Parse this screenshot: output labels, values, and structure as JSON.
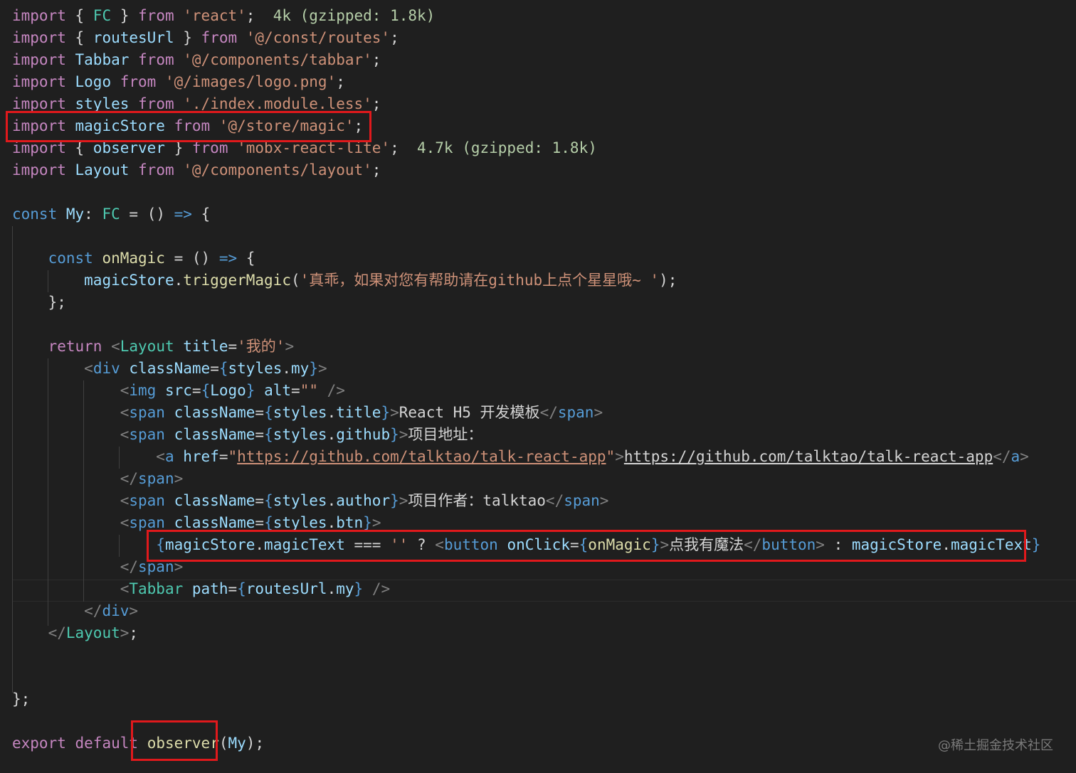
{
  "colors": {
    "background": "#1f1f1f",
    "keyword": "#c586c0",
    "storage_keyword": "#569cd6",
    "variable": "#9cdcfe",
    "type": "#4ec9b0",
    "function": "#dcdcaa",
    "string": "#ce9178",
    "tag": "#569cd6",
    "attribute": "#9cdcfe",
    "jsx_bracket": "#808080",
    "text": "#d4d4d4",
    "import_cost_hint": "#b5cea8",
    "annotation_box": "#e0191c"
  },
  "code_lines": [
    {
      "tokens": [
        {
          "t": "import",
          "c": "kw"
        },
        {
          "t": " { ",
          "c": "punc"
        },
        {
          "t": "FC",
          "c": "type"
        },
        {
          "t": " } ",
          "c": "punc"
        },
        {
          "t": "from",
          "c": "kw"
        },
        {
          "t": " ",
          "c": "punc"
        },
        {
          "t": "'react'",
          "c": "str"
        },
        {
          "t": ";  ",
          "c": "punc"
        },
        {
          "t": "4k (gzipped: 1.8k)",
          "c": "hint"
        }
      ]
    },
    {
      "tokens": [
        {
          "t": "import",
          "c": "kw"
        },
        {
          "t": " { ",
          "c": "punc"
        },
        {
          "t": "routesUrl",
          "c": "var"
        },
        {
          "t": " } ",
          "c": "punc"
        },
        {
          "t": "from",
          "c": "kw"
        },
        {
          "t": " ",
          "c": "punc"
        },
        {
          "t": "'@/const/routes'",
          "c": "str"
        },
        {
          "t": ";",
          "c": "punc"
        }
      ]
    },
    {
      "tokens": [
        {
          "t": "import",
          "c": "kw"
        },
        {
          "t": " ",
          "c": "punc"
        },
        {
          "t": "Tabbar",
          "c": "var"
        },
        {
          "t": " ",
          "c": "punc"
        },
        {
          "t": "from",
          "c": "kw"
        },
        {
          "t": " ",
          "c": "punc"
        },
        {
          "t": "'@/components/tabbar'",
          "c": "str"
        },
        {
          "t": ";",
          "c": "punc"
        }
      ]
    },
    {
      "tokens": [
        {
          "t": "import",
          "c": "kw"
        },
        {
          "t": " ",
          "c": "punc"
        },
        {
          "t": "Logo",
          "c": "var"
        },
        {
          "t": " ",
          "c": "punc"
        },
        {
          "t": "from",
          "c": "kw"
        },
        {
          "t": " ",
          "c": "punc"
        },
        {
          "t": "'@/images/logo.png'",
          "c": "str"
        },
        {
          "t": ";",
          "c": "punc"
        }
      ]
    },
    {
      "tokens": [
        {
          "t": "import",
          "c": "kw"
        },
        {
          "t": " ",
          "c": "punc"
        },
        {
          "t": "styles",
          "c": "var"
        },
        {
          "t": " ",
          "c": "punc"
        },
        {
          "t": "from",
          "c": "kw"
        },
        {
          "t": " ",
          "c": "punc"
        },
        {
          "t": "'./index.module.less'",
          "c": "str"
        },
        {
          "t": ";",
          "c": "punc"
        }
      ]
    },
    {
      "tokens": [
        {
          "t": "import",
          "c": "kw"
        },
        {
          "t": " ",
          "c": "punc"
        },
        {
          "t": "magicStore",
          "c": "var"
        },
        {
          "t": " ",
          "c": "punc"
        },
        {
          "t": "from",
          "c": "kw"
        },
        {
          "t": " ",
          "c": "punc"
        },
        {
          "t": "'@/store/magic'",
          "c": "str"
        },
        {
          "t": ";",
          "c": "punc"
        }
      ]
    },
    {
      "tokens": [
        {
          "t": "import",
          "c": "kw"
        },
        {
          "t": " { ",
          "c": "punc"
        },
        {
          "t": "observer",
          "c": "var"
        },
        {
          "t": " } ",
          "c": "punc"
        },
        {
          "t": "from",
          "c": "kw"
        },
        {
          "t": " ",
          "c": "punc"
        },
        {
          "t": "'mobx-react-lite'",
          "c": "str"
        },
        {
          "t": ";  ",
          "c": "punc"
        },
        {
          "t": "4.7k (gzipped: 1.8k)",
          "c": "hint"
        }
      ]
    },
    {
      "tokens": [
        {
          "t": "import",
          "c": "kw"
        },
        {
          "t": " ",
          "c": "punc"
        },
        {
          "t": "Layout",
          "c": "var"
        },
        {
          "t": " ",
          "c": "punc"
        },
        {
          "t": "from",
          "c": "kw"
        },
        {
          "t": " ",
          "c": "punc"
        },
        {
          "t": "'@/components/layout'",
          "c": "str"
        },
        {
          "t": ";",
          "c": "punc"
        }
      ]
    },
    {
      "tokens": []
    },
    {
      "tokens": [
        {
          "t": "const",
          "c": "sk"
        },
        {
          "t": " ",
          "c": "punc"
        },
        {
          "t": "My",
          "c": "var"
        },
        {
          "t": ": ",
          "c": "punc"
        },
        {
          "t": "FC",
          "c": "type"
        },
        {
          "t": " = () ",
          "c": "punc"
        },
        {
          "t": "=>",
          "c": "sk"
        },
        {
          "t": " {",
          "c": "punc"
        }
      ]
    },
    {
      "tokens": []
    },
    {
      "tokens": [
        {
          "t": "    ",
          "c": "punc"
        },
        {
          "t": "const",
          "c": "sk"
        },
        {
          "t": " ",
          "c": "punc"
        },
        {
          "t": "onMagic",
          "c": "fn"
        },
        {
          "t": " = () ",
          "c": "punc"
        },
        {
          "t": "=>",
          "c": "sk"
        },
        {
          "t": " {",
          "c": "punc"
        }
      ]
    },
    {
      "tokens": [
        {
          "t": "        ",
          "c": "punc"
        },
        {
          "t": "magicStore",
          "c": "var"
        },
        {
          "t": ".",
          "c": "punc"
        },
        {
          "t": "triggerMagic",
          "c": "fn"
        },
        {
          "t": "(",
          "c": "punc"
        },
        {
          "t": "'真乖，如果对您有帮助请在github上点个星星哦~ '",
          "c": "str"
        },
        {
          "t": ");",
          "c": "punc"
        }
      ]
    },
    {
      "tokens": [
        {
          "t": "    };",
          "c": "punc"
        }
      ]
    },
    {
      "tokens": []
    },
    {
      "tokens": [
        {
          "t": "    ",
          "c": "punc"
        },
        {
          "t": "return",
          "c": "kw"
        },
        {
          "t": " ",
          "c": "punc"
        },
        {
          "t": "<",
          "c": "br"
        },
        {
          "t": "Layout",
          "c": "type"
        },
        {
          "t": " ",
          "c": "punc"
        },
        {
          "t": "title",
          "c": "attr"
        },
        {
          "t": "=",
          "c": "punc"
        },
        {
          "t": "'我的'",
          "c": "str"
        },
        {
          "t": ">",
          "c": "br"
        }
      ]
    },
    {
      "tokens": [
        {
          "t": "        ",
          "c": "punc"
        },
        {
          "t": "<",
          "c": "br"
        },
        {
          "t": "div",
          "c": "tag"
        },
        {
          "t": " ",
          "c": "punc"
        },
        {
          "t": "className",
          "c": "attr"
        },
        {
          "t": "=",
          "c": "punc"
        },
        {
          "t": "{",
          "c": "sk"
        },
        {
          "t": "styles",
          "c": "var"
        },
        {
          "t": ".",
          "c": "punc"
        },
        {
          "t": "my",
          "c": "var"
        },
        {
          "t": "}",
          "c": "sk"
        },
        {
          "t": ">",
          "c": "br"
        }
      ]
    },
    {
      "tokens": [
        {
          "t": "            ",
          "c": "punc"
        },
        {
          "t": "<",
          "c": "br"
        },
        {
          "t": "img",
          "c": "tag"
        },
        {
          "t": " ",
          "c": "punc"
        },
        {
          "t": "src",
          "c": "attr"
        },
        {
          "t": "=",
          "c": "punc"
        },
        {
          "t": "{",
          "c": "sk"
        },
        {
          "t": "Logo",
          "c": "var"
        },
        {
          "t": "}",
          "c": "sk"
        },
        {
          "t": " ",
          "c": "punc"
        },
        {
          "t": "alt",
          "c": "attr"
        },
        {
          "t": "=",
          "c": "punc"
        },
        {
          "t": "\"\"",
          "c": "str"
        },
        {
          "t": " />",
          "c": "br"
        }
      ]
    },
    {
      "tokens": [
        {
          "t": "            ",
          "c": "punc"
        },
        {
          "t": "<",
          "c": "br"
        },
        {
          "t": "span",
          "c": "tag"
        },
        {
          "t": " ",
          "c": "punc"
        },
        {
          "t": "className",
          "c": "attr"
        },
        {
          "t": "=",
          "c": "punc"
        },
        {
          "t": "{",
          "c": "sk"
        },
        {
          "t": "styles",
          "c": "var"
        },
        {
          "t": ".",
          "c": "punc"
        },
        {
          "t": "title",
          "c": "var"
        },
        {
          "t": "}",
          "c": "sk"
        },
        {
          "t": ">",
          "c": "br"
        },
        {
          "t": "React H5 开发模板",
          "c": "txt"
        },
        {
          "t": "</",
          "c": "br"
        },
        {
          "t": "span",
          "c": "tag"
        },
        {
          "t": ">",
          "c": "br"
        }
      ]
    },
    {
      "tokens": [
        {
          "t": "            ",
          "c": "punc"
        },
        {
          "t": "<",
          "c": "br"
        },
        {
          "t": "span",
          "c": "tag"
        },
        {
          "t": " ",
          "c": "punc"
        },
        {
          "t": "className",
          "c": "attr"
        },
        {
          "t": "=",
          "c": "punc"
        },
        {
          "t": "{",
          "c": "sk"
        },
        {
          "t": "styles",
          "c": "var"
        },
        {
          "t": ".",
          "c": "punc"
        },
        {
          "t": "github",
          "c": "var"
        },
        {
          "t": "}",
          "c": "sk"
        },
        {
          "t": ">",
          "c": "br"
        },
        {
          "t": "项目地址：",
          "c": "txt"
        }
      ]
    },
    {
      "tokens": [
        {
          "t": "                ",
          "c": "punc"
        },
        {
          "t": "<",
          "c": "br"
        },
        {
          "t": "a",
          "c": "tag"
        },
        {
          "t": " ",
          "c": "punc"
        },
        {
          "t": "href",
          "c": "attr"
        },
        {
          "t": "=",
          "c": "punc"
        },
        {
          "t": "\"",
          "c": "str"
        },
        {
          "t": "https://github.com/talktao/talk-react-app",
          "c": "str",
          "u": true
        },
        {
          "t": "\"",
          "c": "str"
        },
        {
          "t": ">",
          "c": "br"
        },
        {
          "t": "https://github.com/talktao/talk-react-app",
          "c": "txt",
          "u": true
        },
        {
          "t": "</",
          "c": "br"
        },
        {
          "t": "a",
          "c": "tag"
        },
        {
          "t": ">",
          "c": "br"
        }
      ]
    },
    {
      "tokens": [
        {
          "t": "            ",
          "c": "punc"
        },
        {
          "t": "</",
          "c": "br"
        },
        {
          "t": "span",
          "c": "tag"
        },
        {
          "t": ">",
          "c": "br"
        }
      ]
    },
    {
      "tokens": [
        {
          "t": "            ",
          "c": "punc"
        },
        {
          "t": "<",
          "c": "br"
        },
        {
          "t": "span",
          "c": "tag"
        },
        {
          "t": " ",
          "c": "punc"
        },
        {
          "t": "className",
          "c": "attr"
        },
        {
          "t": "=",
          "c": "punc"
        },
        {
          "t": "{",
          "c": "sk"
        },
        {
          "t": "styles",
          "c": "var"
        },
        {
          "t": ".",
          "c": "punc"
        },
        {
          "t": "author",
          "c": "var"
        },
        {
          "t": "}",
          "c": "sk"
        },
        {
          "t": ">",
          "c": "br"
        },
        {
          "t": "项目作者：talktao",
          "c": "txt"
        },
        {
          "t": "</",
          "c": "br"
        },
        {
          "t": "span",
          "c": "tag"
        },
        {
          "t": ">",
          "c": "br"
        }
      ]
    },
    {
      "tokens": [
        {
          "t": "            ",
          "c": "punc"
        },
        {
          "t": "<",
          "c": "br"
        },
        {
          "t": "span",
          "c": "tag"
        },
        {
          "t": " ",
          "c": "punc"
        },
        {
          "t": "className",
          "c": "attr"
        },
        {
          "t": "=",
          "c": "punc"
        },
        {
          "t": "{",
          "c": "sk"
        },
        {
          "t": "styles",
          "c": "var"
        },
        {
          "t": ".",
          "c": "punc"
        },
        {
          "t": "btn",
          "c": "var"
        },
        {
          "t": "}",
          "c": "sk"
        },
        {
          "t": ">",
          "c": "br"
        }
      ]
    },
    {
      "tokens": [
        {
          "t": "                ",
          "c": "punc"
        },
        {
          "t": "{",
          "c": "sk"
        },
        {
          "t": "magicStore",
          "c": "var"
        },
        {
          "t": ".",
          "c": "punc"
        },
        {
          "t": "magicText",
          "c": "var"
        },
        {
          "t": " === ",
          "c": "punc"
        },
        {
          "t": "''",
          "c": "str"
        },
        {
          "t": " ? ",
          "c": "punc"
        },
        {
          "t": "<",
          "c": "br"
        },
        {
          "t": "button",
          "c": "tag"
        },
        {
          "t": " ",
          "c": "punc"
        },
        {
          "t": "onClick",
          "c": "attr"
        },
        {
          "t": "=",
          "c": "punc"
        },
        {
          "t": "{",
          "c": "sk"
        },
        {
          "t": "onMagic",
          "c": "fn"
        },
        {
          "t": "}",
          "c": "sk"
        },
        {
          "t": ">",
          "c": "br"
        },
        {
          "t": "点我有魔法",
          "c": "txt"
        },
        {
          "t": "</",
          "c": "br"
        },
        {
          "t": "button",
          "c": "tag"
        },
        {
          "t": ">",
          "c": "br"
        },
        {
          "t": " : ",
          "c": "punc"
        },
        {
          "t": "magicStore",
          "c": "var"
        },
        {
          "t": ".",
          "c": "punc"
        },
        {
          "t": "magicText",
          "c": "var"
        },
        {
          "t": "}",
          "c": "sk"
        }
      ]
    },
    {
      "tokens": [
        {
          "t": "            ",
          "c": "punc"
        },
        {
          "t": "</",
          "c": "br"
        },
        {
          "t": "span",
          "c": "tag"
        },
        {
          "t": ">",
          "c": "br"
        }
      ]
    },
    {
      "tokens": [
        {
          "t": "            ",
          "c": "punc"
        },
        {
          "t": "<",
          "c": "br"
        },
        {
          "t": "Tabbar",
          "c": "type"
        },
        {
          "t": " ",
          "c": "punc"
        },
        {
          "t": "path",
          "c": "attr"
        },
        {
          "t": "=",
          "c": "punc"
        },
        {
          "t": "{",
          "c": "sk"
        },
        {
          "t": "routesUrl",
          "c": "var"
        },
        {
          "t": ".",
          "c": "punc"
        },
        {
          "t": "my",
          "c": "var"
        },
        {
          "t": "}",
          "c": "sk"
        },
        {
          "t": " />",
          "c": "br"
        }
      ]
    },
    {
      "tokens": [
        {
          "t": "        ",
          "c": "punc"
        },
        {
          "t": "</",
          "c": "br"
        },
        {
          "t": "div",
          "c": "tag"
        },
        {
          "t": ">",
          "c": "br"
        }
      ]
    },
    {
      "tokens": [
        {
          "t": "    ",
          "c": "punc"
        },
        {
          "t": "</",
          "c": "br"
        },
        {
          "t": "Layout",
          "c": "type"
        },
        {
          "t": ">",
          "c": "br"
        },
        {
          "t": ";",
          "c": "punc"
        }
      ]
    },
    {
      "tokens": []
    },
    {
      "tokens": []
    },
    {
      "tokens": [
        {
          "t": "};",
          "c": "punc"
        }
      ]
    },
    {
      "tokens": []
    },
    {
      "tokens": [
        {
          "t": "export",
          "c": "kw"
        },
        {
          "t": " ",
          "c": "punc"
        },
        {
          "t": "default",
          "c": "kw"
        },
        {
          "t": " ",
          "c": "punc"
        },
        {
          "t": "observer",
          "c": "fn"
        },
        {
          "t": "(",
          "c": "punc"
        },
        {
          "t": "My",
          "c": "var"
        },
        {
          "t": ");",
          "c": "punc"
        }
      ]
    }
  ],
  "watermark": "@稀土掘金技术社区"
}
